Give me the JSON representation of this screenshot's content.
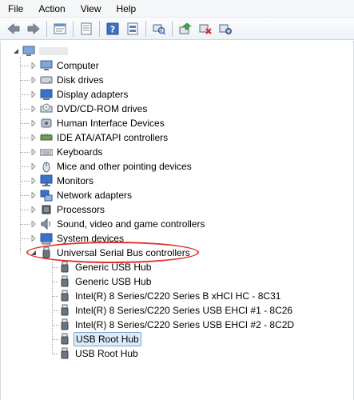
{
  "menu": [
    "File",
    "Action",
    "View",
    "Help"
  ],
  "toolbar": {
    "buttons": [
      "back-icon",
      "forward-icon",
      "properties-icon",
      "show-hidden-icon",
      "help-icon",
      "device-view-icon",
      "scan-hardware-icon",
      "update-driver-icon",
      "uninstall-icon",
      "disable-icon"
    ]
  },
  "tree": {
    "root_label": "",
    "categories": [
      {
        "label": "Computer",
        "icon": "computer-icon"
      },
      {
        "label": "Disk drives",
        "icon": "disk-drive-icon"
      },
      {
        "label": "Display adapters",
        "icon": "display-adapter-icon"
      },
      {
        "label": "DVD/CD-ROM drives",
        "icon": "dvd-drive-icon"
      },
      {
        "label": "Human Interface Devices",
        "icon": "hid-icon"
      },
      {
        "label": "IDE ATA/ATAPI controllers",
        "icon": "ide-controller-icon"
      },
      {
        "label": "Keyboards",
        "icon": "keyboard-icon"
      },
      {
        "label": "Mice and other pointing devices",
        "icon": "mouse-icon"
      },
      {
        "label": "Monitors",
        "icon": "monitor-icon"
      },
      {
        "label": "Network adapters",
        "icon": "network-adapter-icon"
      },
      {
        "label": "Processors",
        "icon": "processor-icon"
      },
      {
        "label": "Sound, video and game controllers",
        "icon": "sound-icon"
      },
      {
        "label": "System devices",
        "icon": "system-devices-icon"
      }
    ],
    "usb": {
      "label": "Universal Serial Bus controllers",
      "children": [
        {
          "label": "Generic USB Hub"
        },
        {
          "label": "Generic USB Hub"
        },
        {
          "label": "Intel(R) 8 Series/C220 Series  B xHCI HC - 8C31"
        },
        {
          "label": "Intel(R) 8 Series/C220 Series  USB EHCI #1 - 8C26"
        },
        {
          "label": "Intel(R) 8 Series/C220 Series  USB EHCI #2 - 8C2D"
        },
        {
          "label": "USB Root Hub",
          "selected": true
        },
        {
          "label": "USB Root Hub"
        }
      ]
    }
  },
  "colors": {
    "highlight_ellipse": "#e0322d",
    "selection_bg": "#dcebfc"
  }
}
